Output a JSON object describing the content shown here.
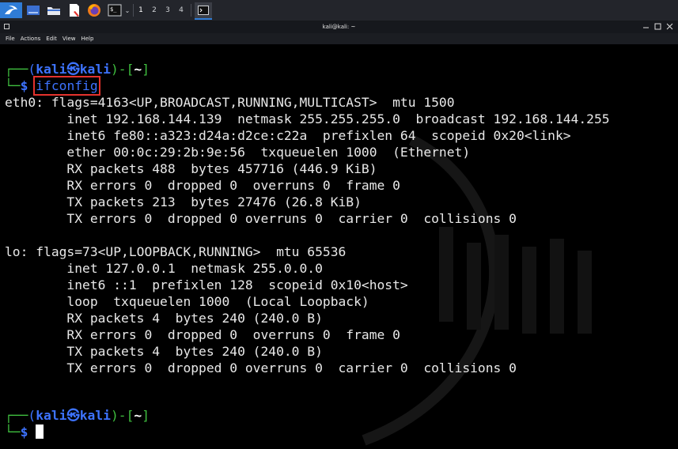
{
  "panel": {
    "workspaces": [
      "1",
      "2",
      "3",
      "4"
    ]
  },
  "window": {
    "title": "kali@kali: ~"
  },
  "menubar": {
    "items": [
      "File",
      "Actions",
      "Edit",
      "View",
      "Help"
    ]
  },
  "terminal": {
    "prompt": {
      "open_paren": "(",
      "user": "kali",
      "at_symbol": "㉿",
      "host": "kali",
      "mid": ")-[",
      "dir": "~",
      "close": "]",
      "dollar": "$"
    },
    "command": "ifconfig",
    "output": [
      "eth0: flags=4163<UP,BROADCAST,RUNNING,MULTICAST>  mtu 1500",
      "        inet 192.168.144.139  netmask 255.255.255.0  broadcast 192.168.144.255",
      "        inet6 fe80::a323:d24a:d2ce:c22a  prefixlen 64  scopeid 0x20<link>",
      "        ether 00:0c:29:2b:9e:56  txqueuelen 1000  (Ethernet)",
      "        RX packets 488  bytes 457716 (446.9 KiB)",
      "        RX errors 0  dropped 0  overruns 0  frame 0",
      "        TX packets 213  bytes 27476 (26.8 KiB)",
      "        TX errors 0  dropped 0 overruns 0  carrier 0  collisions 0",
      "",
      "lo: flags=73<UP,LOOPBACK,RUNNING>  mtu 65536",
      "        inet 127.0.0.1  netmask 255.0.0.0",
      "        inet6 ::1  prefixlen 128  scopeid 0x10<host>",
      "        loop  txqueuelen 1000  (Local Loopback)",
      "        RX packets 4  bytes 240 (240.0 B)",
      "        RX errors 0  dropped 0  overruns 0  frame 0",
      "        TX packets 4  bytes 240 (240.0 B)",
      "        TX errors 0  dropped 0 overruns 0  carrier 0  collisions 0"
    ]
  },
  "colors": {
    "prompt_blue": "#3d73ff",
    "prompt_green": "#3fbf3f",
    "highlight_box": "#e5322d",
    "background": "#000000"
  }
}
